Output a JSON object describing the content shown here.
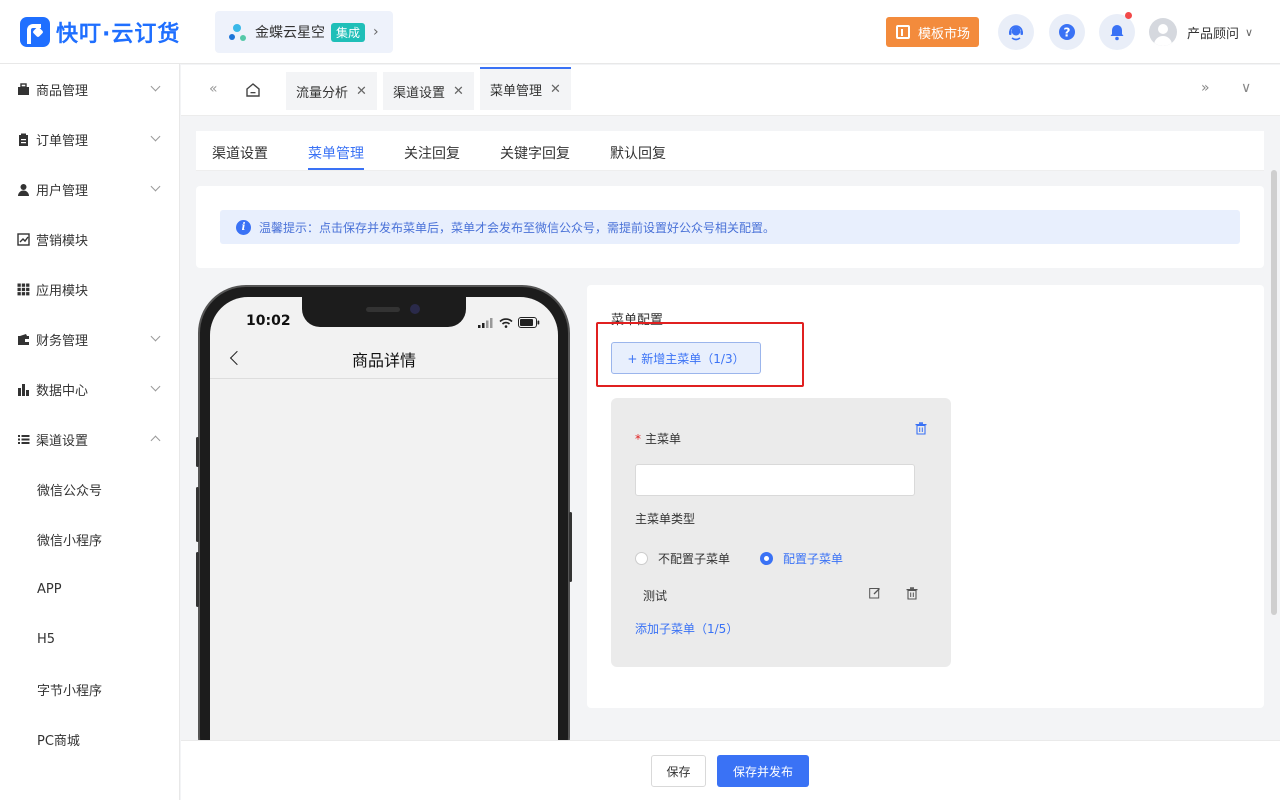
{
  "app": {
    "logo_text": "快叮·云订货",
    "org_name": "金蝶云星空",
    "org_badge": "集成",
    "market_label": "模板市场",
    "user_name": "产品顾问"
  },
  "sidebar": {
    "items": [
      {
        "label": "商品管理",
        "icon": "box-icon",
        "chevron": "down"
      },
      {
        "label": "订单管理",
        "icon": "clipboard-icon",
        "chevron": "down"
      },
      {
        "label": "用户管理",
        "icon": "user-icon",
        "chevron": "down"
      },
      {
        "label": "营销模块",
        "icon": "trend-icon",
        "chevron": ""
      },
      {
        "label": "应用模块",
        "icon": "grid-icon",
        "chevron": ""
      },
      {
        "label": "财务管理",
        "icon": "wallet-icon",
        "chevron": "down"
      },
      {
        "label": "数据中心",
        "icon": "bar-chart-icon",
        "chevron": "down"
      },
      {
        "label": "渠道设置",
        "icon": "list-icon",
        "chevron": "up"
      }
    ],
    "subitems": [
      "微信公众号",
      "微信小程序",
      "APP",
      "H5",
      "字节小程序",
      "PC商城"
    ]
  },
  "page_tabs": [
    {
      "label": "流量分析",
      "close": "✕"
    },
    {
      "label": "渠道设置",
      "close": "✕"
    },
    {
      "label": "菜单管理",
      "close": "✕",
      "active": true
    }
  ],
  "inner_tabs": [
    "渠道设置",
    "菜单管理",
    "关注回复",
    "关键字回复",
    "默认回复"
  ],
  "notice": "温馨提示：点击保存并发布菜单后，菜单才会发布至微信公众号，需提前设置好公众号相关配置。",
  "phone": {
    "time": "10:02",
    "title": "商品详情"
  },
  "config": {
    "title": "菜单配置",
    "add_main_label": "+ 新增主菜单（1/3）",
    "main_menu_label": "主菜单",
    "required_mark": "*",
    "main_menu_value": "",
    "type_label": "主菜单类型",
    "radio_no_sub": "不配置子菜单",
    "radio_with_sub": "配置子菜单",
    "selected_radio": "配置子菜单",
    "sub_item": "测试",
    "add_sub_label": "添加子菜单（1/5）"
  },
  "footer": {
    "save_label": "保存",
    "publish_label": "保存并发布"
  },
  "colors": {
    "primary": "#3a72f5",
    "brand": "#1f6fff",
    "market": "#f38b3c",
    "highlight": "#e02020"
  }
}
